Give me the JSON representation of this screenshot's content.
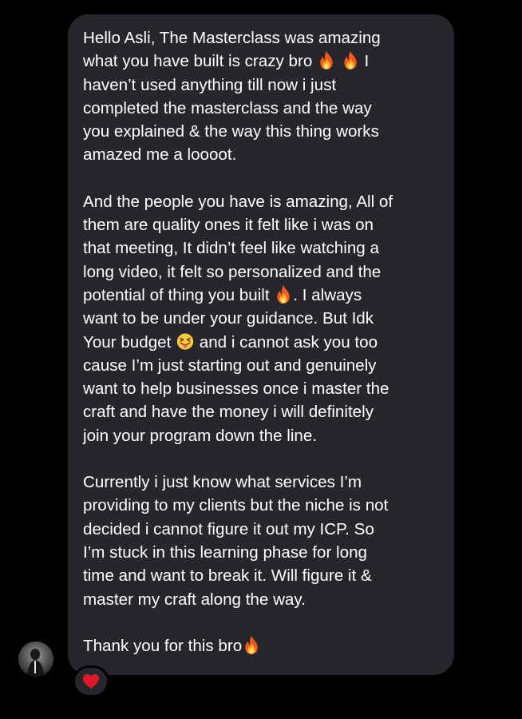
{
  "message": {
    "paragraphs": [
      {
        "lines": [
          [
            {
              "t": "Hello Asli, The Masterclass was amazing"
            }
          ],
          [
            {
              "t": "what you have built is crazy bro "
            },
            {
              "emoji": "fire-emoji"
            },
            {
              "t": " "
            },
            {
              "emoji": "fire-emoji"
            },
            {
              "t": " I"
            }
          ],
          [
            {
              "t": "haven’t used anything till now i just"
            }
          ],
          [
            {
              "t": "completed the masterclass and the way"
            }
          ],
          [
            {
              "t": "you explained & the way this thing works"
            }
          ],
          [
            {
              "t": "amazed me a loooot."
            }
          ]
        ]
      },
      {
        "lines": [
          [
            {
              "t": "And the people you have is amazing, All of"
            }
          ],
          [
            {
              "t": "them are quality ones it felt like i was on"
            }
          ],
          [
            {
              "t": "that meeting, It didn’t feel like watching a"
            }
          ],
          [
            {
              "t": "long video, it felt so personalized and the"
            }
          ],
          [
            {
              "t": "potential of thing you built "
            },
            {
              "emoji": "fire-emoji"
            },
            {
              "t": ". I always"
            }
          ],
          [
            {
              "t": "want to be under your guidance. But Idk"
            }
          ],
          [
            {
              "t": "Your budget "
            },
            {
              "emoji": "squinting-tongue-emoji"
            },
            {
              "t": " and i cannot ask you too"
            }
          ],
          [
            {
              "t": "cause I’m just starting out and genuinely"
            }
          ],
          [
            {
              "t": "want to help businesses once i master the"
            }
          ],
          [
            {
              "t": "craft and have the money i will definitely"
            }
          ],
          [
            {
              "t": "join your program down the line."
            }
          ]
        ]
      },
      {
        "lines": [
          [
            {
              "t": "Currently i just know what services I’m"
            }
          ],
          [
            {
              "t": "providing to my clients but the niche is not"
            }
          ],
          [
            {
              "t": "decided i cannot figure it out my ICP. So"
            }
          ],
          [
            {
              "t": "I’m stuck in this learning phase for long"
            }
          ],
          [
            {
              "t": "time and want to break it. Will figure it &"
            }
          ],
          [
            {
              "t": "master my craft along the way."
            }
          ]
        ]
      },
      {
        "lines": [
          [
            {
              "t": "Thank you for this bro"
            },
            {
              "emoji": "fire-emoji"
            }
          ]
        ]
      }
    ]
  },
  "reaction": {
    "icon": "heart-icon",
    "color": "#e0182d"
  },
  "colors": {
    "background": "#000000",
    "bubble": "#26272c",
    "text": "#ffffff"
  }
}
